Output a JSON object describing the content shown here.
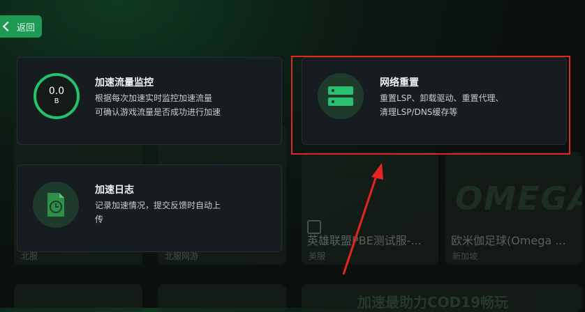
{
  "back": {
    "label": "返回"
  },
  "cards": {
    "traffic": {
      "title": "加速流量监控",
      "desc1": "根据每次加速实时监控加速流量",
      "desc2": "可确认游戏流量是否成功进行加速",
      "gauge_value": "0.0",
      "gauge_unit": "B"
    },
    "network_reset": {
      "title": "网络重置",
      "desc1": "重置LSP、卸载驱动、重置代理、",
      "desc2": "清理LSP/DNS缓存等"
    },
    "log": {
      "title": "加速日志",
      "desc1": "记录加速情况，提交反馈时自动上",
      "desc2": "传"
    }
  },
  "background_tiles": {
    "tile1": {
      "title": "英雄联盟PBE测试服-...",
      "region": "美服"
    },
    "tile2": {
      "title": "欧米伽足球(Omega ...",
      "region": "新加坡",
      "logo": "OMEGA"
    },
    "tile3": {
      "region": "北服"
    },
    "tile4": {
      "region": "北服网游"
    },
    "tile5": {
      "banner": "加速最助力COD19畅玩"
    }
  },
  "colors": {
    "accent": "#1f9a55",
    "highlight": "#e42520",
    "card_bg": "#171c20"
  }
}
